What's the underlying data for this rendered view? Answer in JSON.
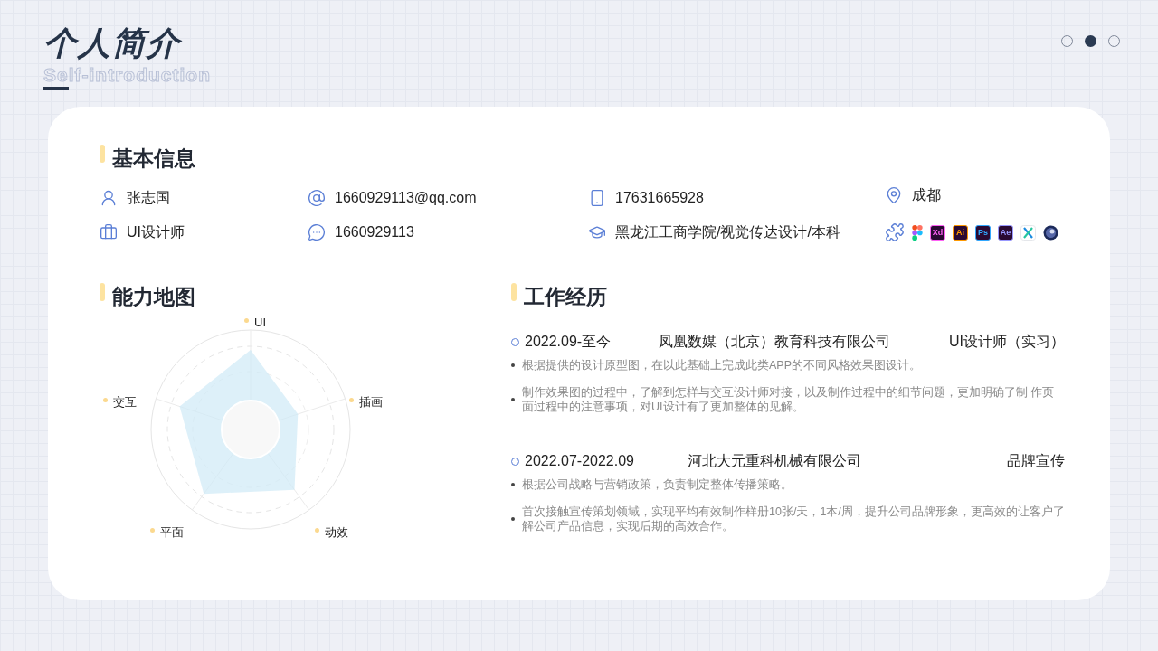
{
  "header": {
    "title": "个人简介",
    "subtitle": "Self-introduction"
  },
  "pages": [
    {
      "selected": false
    },
    {
      "selected": true
    },
    {
      "selected": false
    }
  ],
  "basic_info": {
    "title": "基本信息",
    "items": [
      {
        "kind": "person",
        "text": "张志国"
      },
      {
        "kind": "at",
        "text": "1660929113@qq.com"
      },
      {
        "kind": "phone",
        "text": "17631665928"
      },
      {
        "kind": "location",
        "text": "成都"
      },
      {
        "kind": "briefcase",
        "text": "UI设计师"
      },
      {
        "kind": "chat",
        "text": "1660929113"
      },
      {
        "kind": "education",
        "text": "黑龙江工商学院/视觉传达设计/本科"
      },
      {
        "kind": "tools",
        "tools": [
          {
            "kind": "plugin"
          },
          {
            "kind": "figma"
          },
          {
            "kind": "badge",
            "label": "Xd",
            "color": "#ff61f6"
          },
          {
            "kind": "badge",
            "label": "Ai",
            "color": "#ff9a00"
          },
          {
            "kind": "badge",
            "label": "Ps",
            "color": "#31a8ff"
          },
          {
            "kind": "badge",
            "label": "Ae",
            "color": "#9999ff"
          },
          {
            "kind": "axure"
          },
          {
            "kind": "cinema"
          }
        ]
      }
    ]
  },
  "skills": {
    "title": "能力地图",
    "axes": [
      "UI",
      "插画",
      "动效",
      "平面",
      "交互"
    ]
  },
  "experience": {
    "title": "工作经历",
    "jobs": [
      {
        "period": "2022.09-至今",
        "company": "凤凰数媒（北京）教育科技有限公司",
        "role": "UI设计师（实习）",
        "points": [
          "根据提供的设计原型图，在以此基础上完成此类APP的不同风格效果图设计。",
          "制作效果图的过程中，了解到怎样与交互设计师对接，以及制作过程中的细节问题，更加明确了制  作页面过程中的注意事项，对UI设计有了更加整体的见解。"
        ]
      },
      {
        "period": "2022.07-2022.09",
        "company": "河北大元重科机械有限公司",
        "role": "品牌宣传",
        "points": [
          "根据公司战略与营销政策，负责制定整体传播策略。",
          "首次接触宣传策划领域，实现平均有效制作样册10张/天，1本/周，提升公司品牌形象，更高效的让客户了解公司产品信息，实现后期的高效合作。"
        ]
      }
    ]
  }
}
